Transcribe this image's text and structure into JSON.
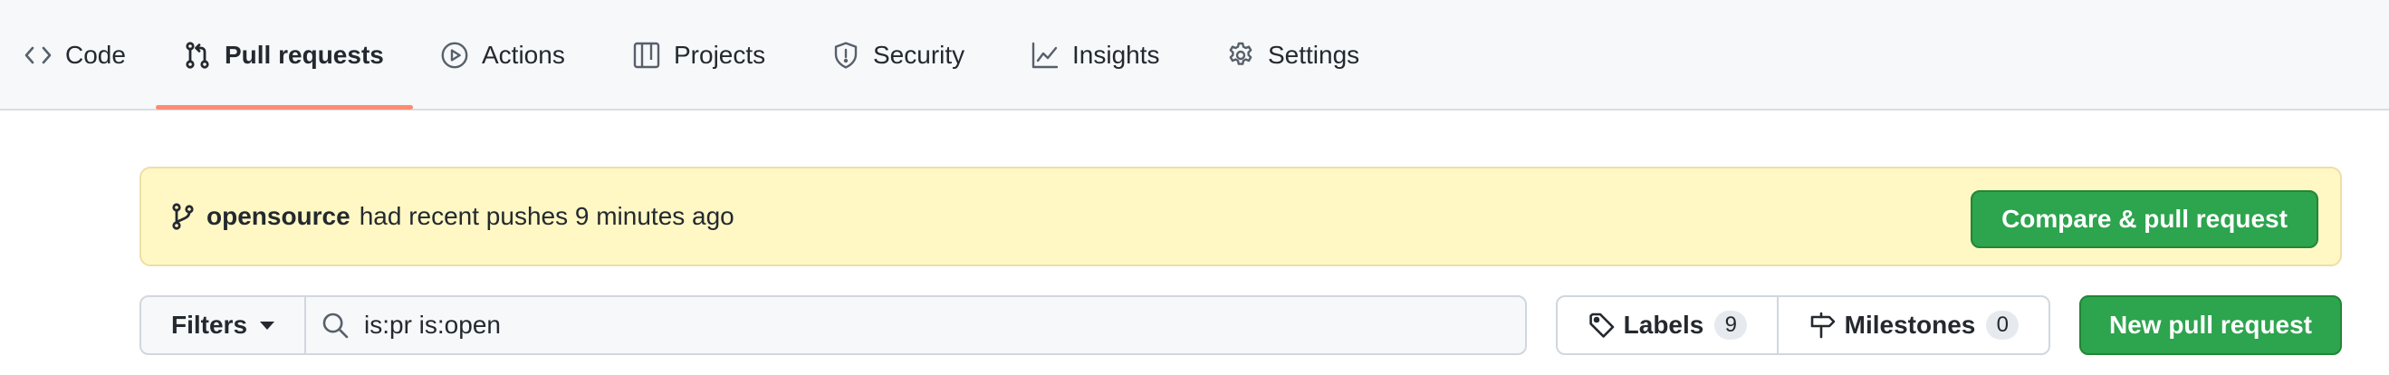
{
  "nav": {
    "tabs": [
      {
        "label": "Code",
        "icon": "code-icon"
      },
      {
        "label": "Pull requests",
        "icon": "git-pull-request-icon",
        "selected": true
      },
      {
        "label": "Actions",
        "icon": "play-icon"
      },
      {
        "label": "Projects",
        "icon": "table-icon"
      },
      {
        "label": "Security",
        "icon": "shield-icon"
      },
      {
        "label": "Insights",
        "icon": "graph-icon"
      },
      {
        "label": "Settings",
        "icon": "gear-icon"
      }
    ],
    "accent_color": "#fd8c73"
  },
  "banner": {
    "branch": "opensource",
    "message": "had recent pushes 9 minutes ago",
    "compare_label": "Compare & pull request",
    "background": "#fff8c5"
  },
  "filters": {
    "filters_label": "Filters",
    "search_value": "is:pr is:open"
  },
  "labels": {
    "label": "Labels",
    "count": "9"
  },
  "milestones": {
    "label": "Milestones",
    "count": "0"
  },
  "new_pr": {
    "label": "New pull request",
    "color": "#2da44e"
  }
}
